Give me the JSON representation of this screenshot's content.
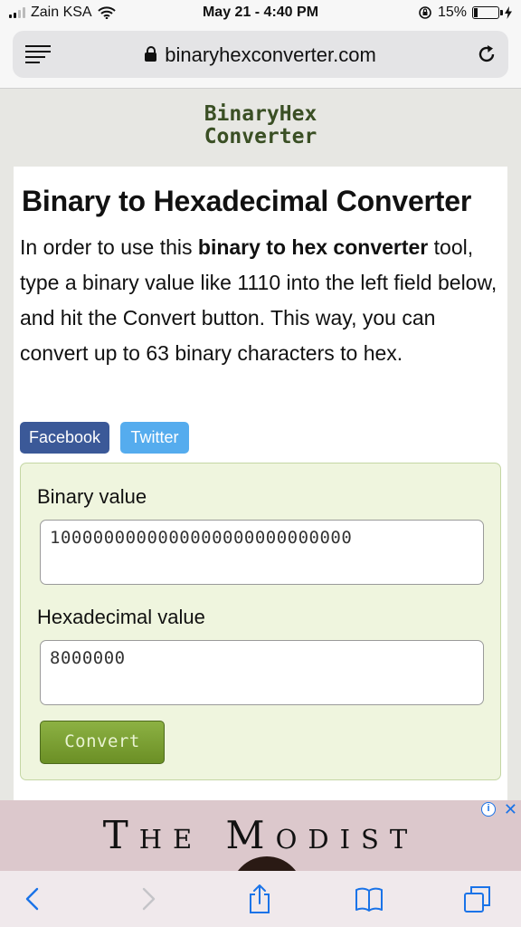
{
  "status_bar": {
    "carrier": "Zain KSA",
    "time": "May 21 - 4:40 PM",
    "battery_percent": "15%",
    "battery_level": 0.15
  },
  "browser": {
    "url": "binaryhexconverter.com"
  },
  "site": {
    "logo_line1": "BinaryHex",
    "logo_line2": "Converter"
  },
  "main": {
    "title": "Binary to Hexadecimal Converter",
    "intro_before": "In order to use this ",
    "intro_bold": "binary to hex converter",
    "intro_after": " tool, type a binary value like 1110 into the left field below, and hit the Convert button. This way, you can convert up to 63 binary characters to hex.",
    "share_facebook": "Facebook",
    "share_twitter": "Twitter"
  },
  "converter": {
    "binary_label": "Binary value",
    "binary_value": "1000000000000000000000000000",
    "hex_label": "Hexadecimal value",
    "hex_value": "8000000",
    "convert_label": "Convert"
  },
  "ad": {
    "title": "The Modist",
    "info": "i",
    "close": "✕"
  },
  "toolbar": {
    "icons": [
      "back-icon",
      "forward-icon",
      "share-icon",
      "bookmarks-icon",
      "tabs-icon"
    ]
  }
}
